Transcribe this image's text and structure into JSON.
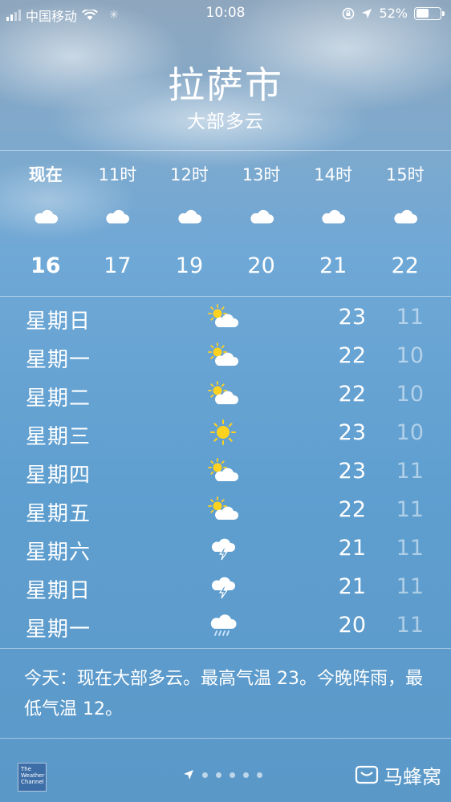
{
  "status_bar": {
    "carrier": "中国移动",
    "time": "10:08",
    "battery": "52%",
    "battery_level": 0.52
  },
  "location": {
    "city": "拉萨市",
    "condition": "大部多云"
  },
  "hourly": [
    {
      "label": "现在",
      "icon": "cloud-icon",
      "temp": "16",
      "now": true
    },
    {
      "label": "11时",
      "icon": "cloud-icon",
      "temp": "17"
    },
    {
      "label": "12时",
      "icon": "cloud-icon",
      "temp": "19"
    },
    {
      "label": "13时",
      "icon": "cloud-icon",
      "temp": "20"
    },
    {
      "label": "14时",
      "icon": "cloud-icon",
      "temp": "21"
    },
    {
      "label": "15时",
      "icon": "cloud-icon",
      "temp": "22"
    }
  ],
  "daily": [
    {
      "day": "星期日",
      "icon": "partly-sunny-icon",
      "high": "23",
      "low": "11"
    },
    {
      "day": "星期一",
      "icon": "partly-sunny-icon",
      "high": "22",
      "low": "10"
    },
    {
      "day": "星期二",
      "icon": "partly-sunny-icon",
      "high": "22",
      "low": "10"
    },
    {
      "day": "星期三",
      "icon": "sun-icon",
      "high": "23",
      "low": "10"
    },
    {
      "day": "星期四",
      "icon": "partly-sunny-icon",
      "high": "23",
      "low": "11"
    },
    {
      "day": "星期五",
      "icon": "partly-sunny-icon",
      "high": "22",
      "low": "11"
    },
    {
      "day": "星期六",
      "icon": "thunderstorm-icon",
      "high": "21",
      "low": "11"
    },
    {
      "day": "星期日",
      "icon": "thunderstorm-icon",
      "high": "21",
      "low": "11"
    },
    {
      "day": "星期一",
      "icon": "rain-icon",
      "high": "20",
      "low": "11"
    }
  ],
  "summary": "今天：现在大部多云。最高气温 23。今晚阵雨，最低气温 12。",
  "footer": {
    "logo_text": "The Weather Channel",
    "watermark": "马蜂窝"
  },
  "colors": {
    "sun": "#ffd21f",
    "text": "#ffffff",
    "low_temp": "rgba(255,255,255,0.5)"
  }
}
